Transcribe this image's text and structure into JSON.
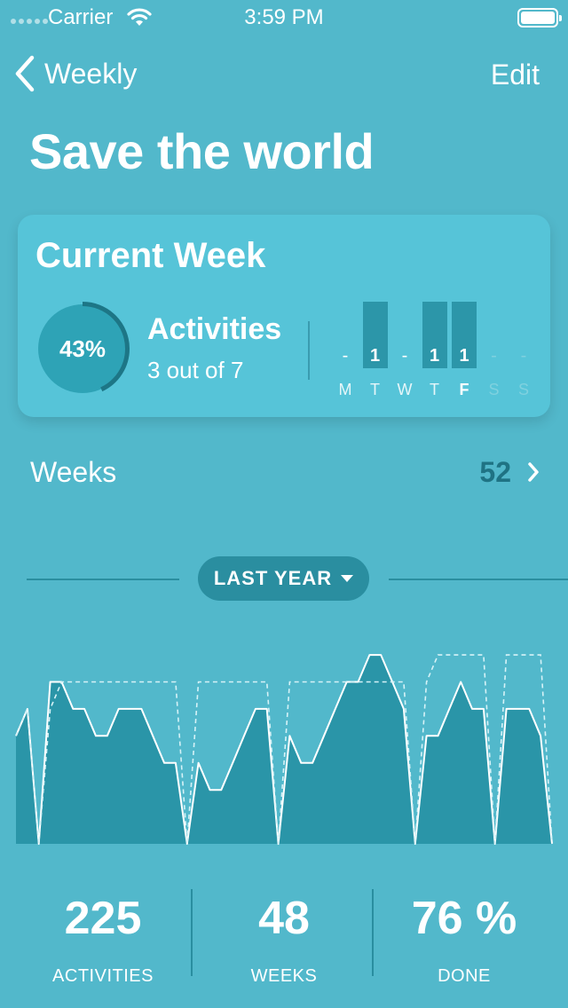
{
  "status_bar": {
    "carrier": "Carrier",
    "time": "3:59 PM"
  },
  "nav": {
    "back_label": "Weekly",
    "edit_label": "Edit"
  },
  "title": "Save the world",
  "current_week": {
    "title": "Current Week",
    "percent_label": "43%",
    "progress": 0.43,
    "activities_title": "Activities",
    "activities_sub": "3 out of 7",
    "days": [
      {
        "letter": "M",
        "value": "-",
        "done": false,
        "state": "past"
      },
      {
        "letter": "T",
        "value": "1",
        "done": true,
        "state": "past"
      },
      {
        "letter": "W",
        "value": "-",
        "done": false,
        "state": "past"
      },
      {
        "letter": "T",
        "value": "1",
        "done": true,
        "state": "past"
      },
      {
        "letter": "F",
        "value": "1",
        "done": true,
        "state": "today"
      },
      {
        "letter": "S",
        "value": "-",
        "done": false,
        "state": "future"
      },
      {
        "letter": "S",
        "value": "-",
        "done": false,
        "state": "future"
      }
    ]
  },
  "weeks": {
    "label": "Weeks",
    "count": "52"
  },
  "range": {
    "label": "LAST YEAR"
  },
  "colors": {
    "background": "#52b8cb",
    "card": "#56c4d8",
    "accent_dark": "#2a8ea0",
    "count_text": "#1f7384"
  },
  "chart_data": {
    "type": "area",
    "x": [
      1,
      2,
      3,
      4,
      5,
      6,
      7,
      8,
      9,
      10,
      11,
      12,
      13,
      14,
      15,
      16,
      17,
      18,
      19,
      20,
      21,
      22,
      23,
      24,
      25,
      26,
      27,
      28,
      29,
      30,
      31,
      32,
      33,
      34,
      35,
      36,
      37,
      38,
      39,
      40,
      41,
      42,
      43,
      44,
      45,
      46,
      47,
      48,
      49,
      50,
      51,
      52
    ],
    "series": [
      {
        "values": [
          4,
          5,
          0,
          6,
          6,
          5,
          5,
          4,
          4,
          5,
          5,
          5,
          4,
          3,
          3,
          0,
          3,
          2,
          2,
          3,
          4,
          5,
          5,
          0,
          4,
          3,
          3,
          4,
          5,
          6,
          6,
          7,
          7,
          6,
          5,
          0,
          4,
          4,
          5,
          6,
          5,
          5,
          0,
          5,
          5,
          5,
          4,
          0
        ]
      },
      {
        "values": [
          4,
          5,
          0,
          5,
          6,
          6,
          6,
          6,
          6,
          6,
          6,
          6,
          6,
          6,
          6,
          0,
          6,
          6,
          6,
          6,
          6,
          6,
          6,
          0,
          6,
          6,
          6,
          6,
          6,
          6,
          6,
          6,
          6,
          6,
          6,
          0,
          6,
          7,
          7,
          7,
          7,
          7,
          0,
          7,
          7,
          7,
          7,
          0
        ]
      }
    ],
    "ylim": [
      0,
      7.2
    ]
  },
  "stats": [
    {
      "value": "225",
      "label": "ACTIVITIES"
    },
    {
      "value": "48",
      "label": "WEEKS"
    },
    {
      "value": "76 %",
      "label": "DONE"
    }
  ]
}
